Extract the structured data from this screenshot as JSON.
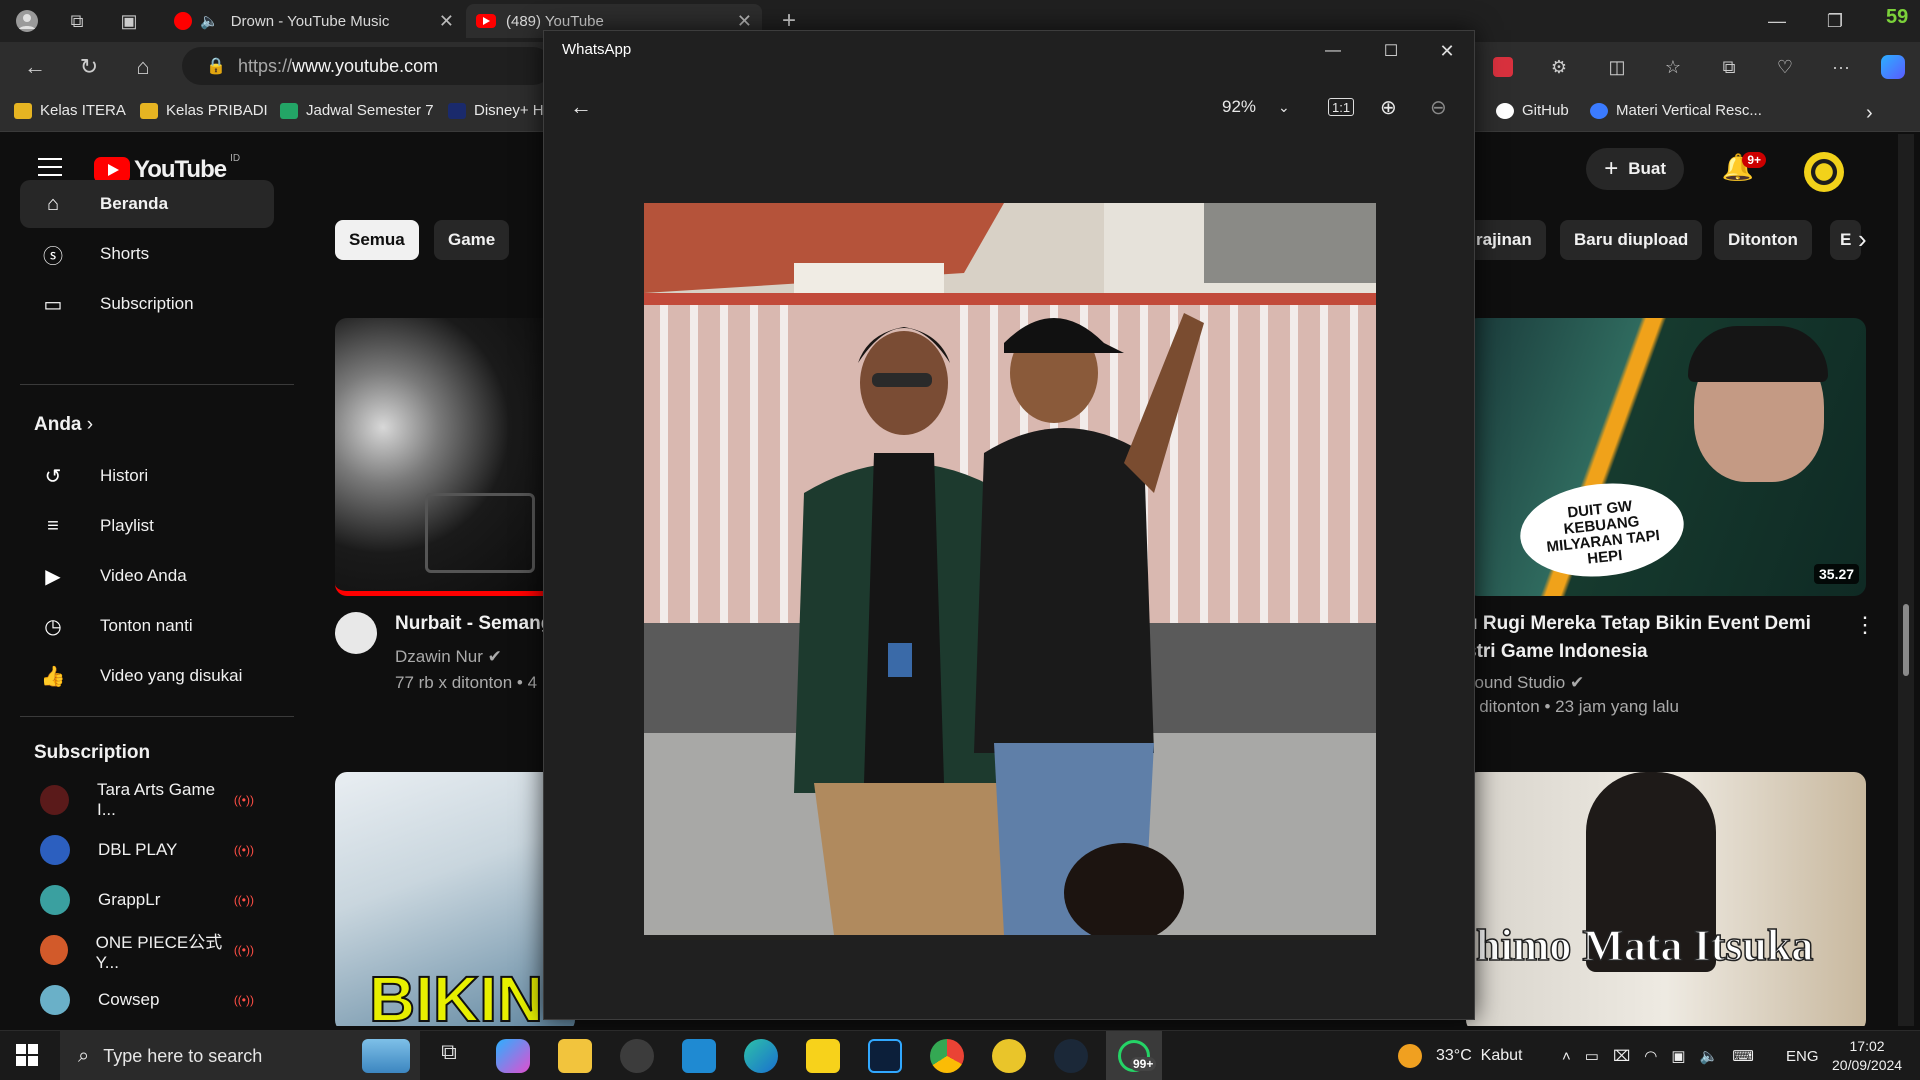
{
  "browser": {
    "tabs": [
      {
        "label": "Drown - YouTube Music"
      },
      {
        "label": "(489) YouTube"
      }
    ],
    "address": {
      "prefix": "https://",
      "host": "www.youtube.com"
    },
    "corner_number": "59",
    "bookmarks_left": [
      "Kelas ITERA",
      "Kelas PRIBADI",
      "Jadwal Semester 7",
      "Disney+ H"
    ],
    "bookmarks_right": [
      "GitHub",
      "Materi Vertical Resc..."
    ]
  },
  "youtube": {
    "logo_text": "YouTube",
    "region": "ID",
    "create_label": "Buat",
    "notif_badge": "9+",
    "sidebar_main": [
      "Beranda",
      "Shorts",
      "Subscription"
    ],
    "you_section": "Anda",
    "you_items": [
      "Histori",
      "Playlist",
      "Video Anda",
      "Tonton nanti",
      "Video yang disukai"
    ],
    "subs_heading": "Subscription",
    "subs": [
      "Tara Arts Game I...",
      "DBL PLAY",
      "GrappLr",
      "ONE PIECE公式Y...",
      "Cowsep"
    ],
    "chips_left": [
      "Semua",
      "Game"
    ],
    "chips_right": [
      "rajinan",
      "Baru diupload",
      "Ditonton",
      "E"
    ],
    "videos": [
      {
        "title": "Nurbait - Semang",
        "channel": "Dzawin Nur",
        "meta": "77 rb x ditonton • 4"
      },
      {
        "title_line1": "u Rugi Mereka Tetap Bikin Event Demi",
        "title_line2": "stri Game Indonesia",
        "channel": "sound Studio",
        "meta": "x ditonton • 23 jam yang lalu",
        "duration": "35.27",
        "bubble": "DUIT GW KEBUANG MILYARAN TAPI HEPI"
      },
      {
        "overlay": "BIKIN S"
      },
      {
        "overlay": "himo Mata Itsuka"
      }
    ]
  },
  "whatsapp": {
    "title": "WhatsApp",
    "zoom": "92%"
  },
  "taskbar": {
    "search_placeholder": "Type here to search",
    "whatsapp_badge": "99+",
    "weather": "33°C  Kabut",
    "language": "ENG",
    "time": "17:02",
    "date": "20/09/2024"
  }
}
